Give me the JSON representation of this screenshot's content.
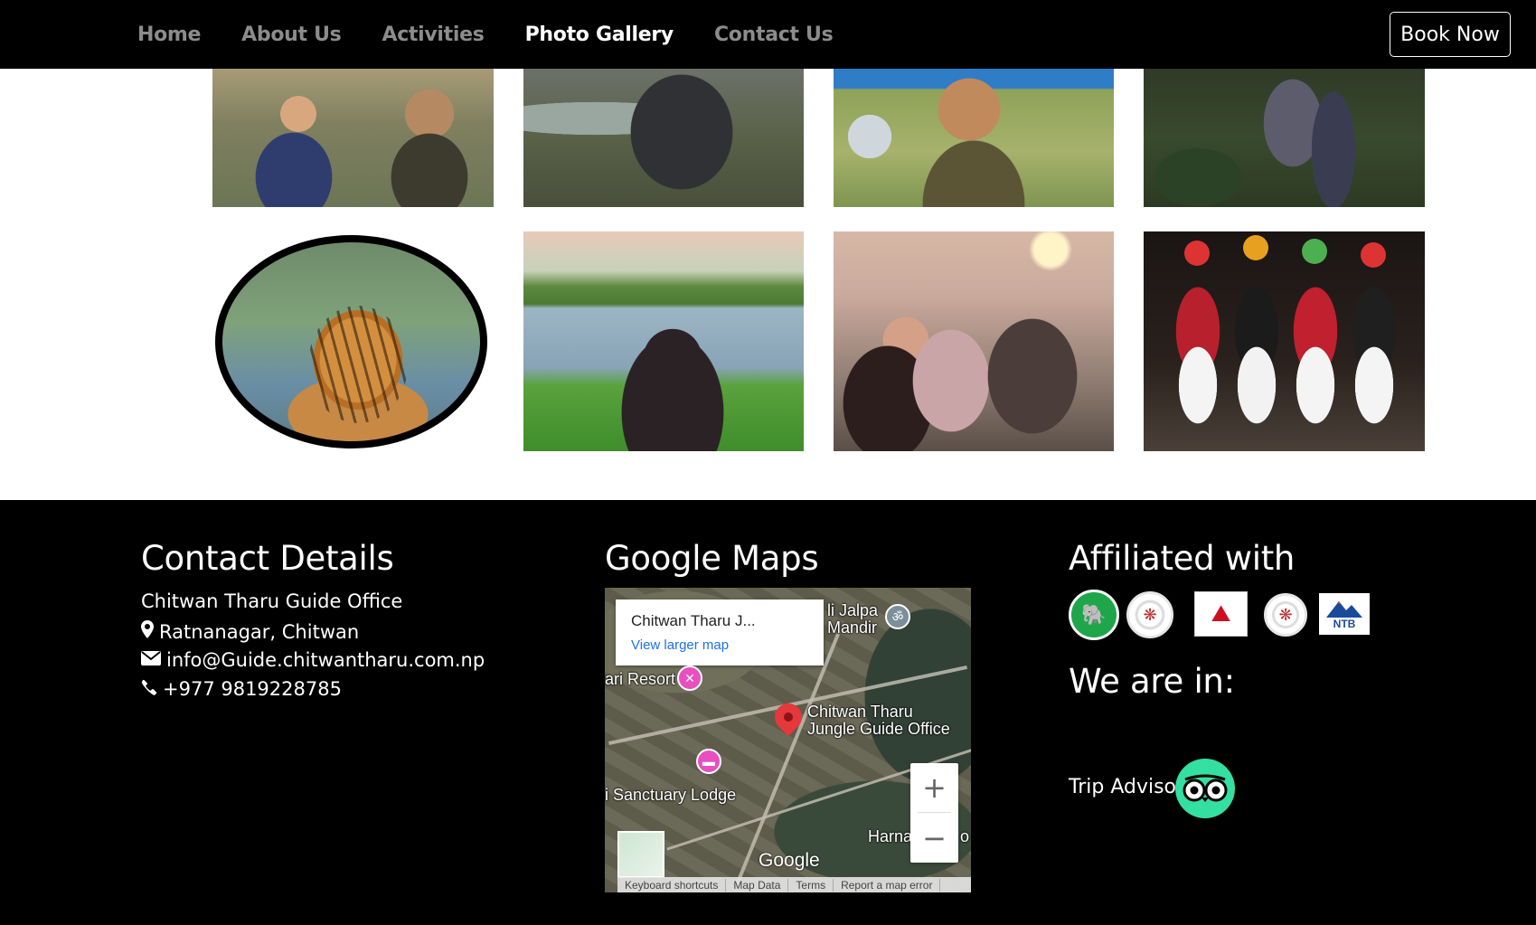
{
  "nav": {
    "links": [
      "Home",
      "About Us",
      "Activities",
      "Photo Gallery",
      "Contact Us"
    ],
    "active": "Photo Gallery",
    "book_button": "Book Now"
  },
  "footer": {
    "contact": {
      "title": "Contact Details",
      "office": "Chitwan Tharu Guide Office",
      "address": "Ratnanagar, Chitwan",
      "email": "info@Guide.chitwantharu.com.np",
      "phone": "+977 9819228785"
    },
    "maps": {
      "title": "Google Maps",
      "card_title": "Chitwan Tharu J...",
      "card_link": "View larger map",
      "pin_label_line1": "Chitwan Tharu",
      "pin_label_line2": "Jungle Guide Office",
      "label_resort": "ari Resort",
      "label_lodge": "i Sanctuary Lodge",
      "label_temple_1": "li Jalpa",
      "label_temple_2": "Mandir",
      "label_harna": "Harna",
      "label_harna_suffix": "o",
      "zoom_in": "+",
      "zoom_out": "−",
      "google": "Google",
      "bottom_bar": [
        "Keyboard shortcuts",
        "Map Data",
        "Terms",
        "Report a map error"
      ]
    },
    "affiliated": {
      "title": "Affiliated with",
      "ntb_text": "NTB"
    },
    "we_are_in": {
      "title": "We are in:",
      "trip_advisor": "Trip Advisor"
    }
  },
  "colors": {
    "nav_bg": "#000000",
    "nav_active": "#ffffff",
    "nav_inactive": "#8c8c8c",
    "footer_bg": "#000000",
    "link_blue": "#1a73e8",
    "tripadvisor_green": "#34e0a1"
  }
}
